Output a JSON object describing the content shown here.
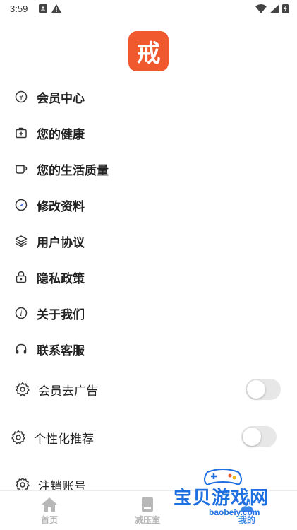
{
  "status_bar": {
    "time": "3:59"
  },
  "app_logo": {
    "char": "戒"
  },
  "menu": [
    {
      "label": "会员中心",
      "icon": "yen-circle-icon"
    },
    {
      "label": "您的健康",
      "icon": "medical-kit-icon"
    },
    {
      "label": "您的生活质量",
      "icon": "coffee-cup-icon"
    },
    {
      "label": "修改资料",
      "icon": "edit-profile-icon"
    },
    {
      "label": "用户协议",
      "icon": "layers-icon"
    },
    {
      "label": "隐私政策",
      "icon": "lock-icon"
    },
    {
      "label": "关于我们",
      "icon": "info-circle-icon"
    },
    {
      "label": "联系客服",
      "icon": "headset-icon"
    }
  ],
  "settings": [
    {
      "label": "会员去广告",
      "icon": "gear-icon",
      "enabled": false
    },
    {
      "label": "个性化推荐",
      "icon": "gear-icon",
      "enabled": false
    },
    {
      "label": "注销账号",
      "icon": "gear-icon"
    }
  ],
  "tabs": [
    {
      "label": "首页",
      "icon": "home-icon"
    },
    {
      "label": "减压室",
      "icon": "book-icon"
    },
    {
      "label": "我的",
      "icon": "profile-icon"
    }
  ],
  "watermark": {
    "title": "宝贝游戏网",
    "url": "baobeiy.com"
  }
}
